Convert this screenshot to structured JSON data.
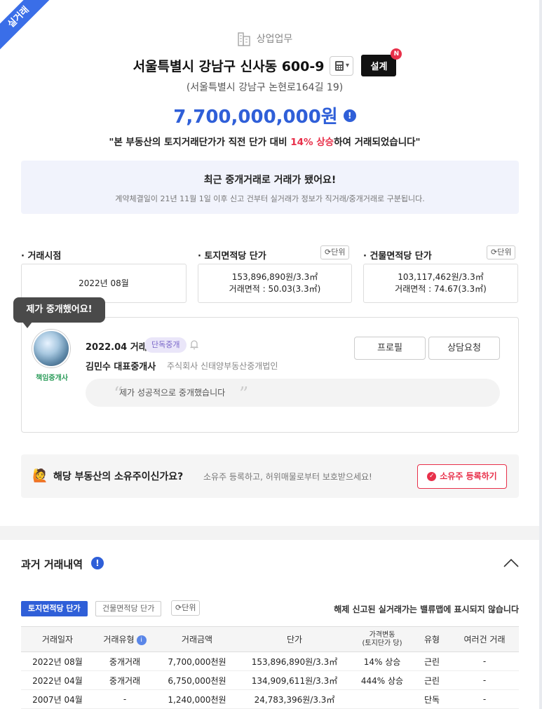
{
  "ribbon": "실거래",
  "header": {
    "category": "상업업무",
    "title": "서울특별시 강남구 신사동 600-9",
    "design_label": "설계",
    "design_badge": "N",
    "address": "(서울특별시 강남구 논현로164길 19)",
    "price": "7,700,000,000원",
    "change_prefix": "\"본 부동산의 토지거래단가가 직전 단가 대비 ",
    "change_highlight": "14% 상승",
    "change_suffix": "하여 거래되었습니다\""
  },
  "notice": {
    "title": "최근 중개거래로 거래가 됐어요!",
    "desc": "계약체결일이 21년 11월 1일 이후 신고 건부터 실거래가 정보가 직거래/중개거래로 구분됩니다."
  },
  "stats": {
    "unit_label": "단위",
    "date_label": "· 거래시점",
    "date_value": "2022년 08월",
    "land_label": "· 토지면적당 단가",
    "land_price": "153,896,890원/3.3㎡",
    "land_area": "거래면적 : 50.03(3.3㎡)",
    "bldg_label": "· 건물면적당 단가",
    "bldg_price": "103,117,462원/3.3㎡",
    "bldg_area": "거래면적 : 74.67(3.3㎡)"
  },
  "agent": {
    "bubble": "제가 중개했어요!",
    "badge": "책임중개사",
    "deal_date": "2022.04 거래",
    "deal_tag": "단독중개",
    "name": "김민수 대표중개사",
    "company": "주식회사 신태양부동산중개법인",
    "profile_btn": "프로필",
    "consult_btn": "상담요청",
    "quote": "제가 성공적으로 중개했습니다"
  },
  "owner": {
    "question": "해당 부동산의 소유주이신가요?",
    "desc": "소유주 등록하고, 허위매물로부터 보호받으세요!",
    "button": "소유주 등록하기"
  },
  "history": {
    "title": "과거 거래내역",
    "tab_land": "토지면적당 단가",
    "tab_bldg": "건물면적당 단가",
    "unit_label": "단위",
    "notice": "해제 신고된 실거래가는 밸류맵에 표시되지 않습니다",
    "columns": {
      "date": "거래일자",
      "type": "거래유형",
      "amount": "거래금액",
      "unit_price": "단가",
      "change_main": "가격변동",
      "change_sub": "(토지단가 당)",
      "kind": "유형",
      "multi": "여러건 거래"
    },
    "rows": [
      {
        "date": "2022년 08월",
        "type": "중개거래",
        "amount": "7,700,000천원",
        "unit_price": "153,896,890원/3.3㎡",
        "change": "14% 상승",
        "kind": "근린",
        "multi": "-"
      },
      {
        "date": "2022년 04월",
        "type": "중개거래",
        "amount": "6,750,000천원",
        "unit_price": "134,909,611원/3.3㎡",
        "change": "444% 상승",
        "kind": "근린",
        "multi": "-"
      },
      {
        "date": "2007년 04월",
        "type": "-",
        "amount": "1,240,000천원",
        "unit_price": "24,783,396원/3.3㎡",
        "change": "",
        "kind": "단독",
        "multi": "-"
      }
    ]
  },
  "colors": {
    "accent": "#2f5fd8",
    "red": "#e8304a",
    "tag_bg": "#eae6f9",
    "tag_text": "#7a67c9"
  }
}
